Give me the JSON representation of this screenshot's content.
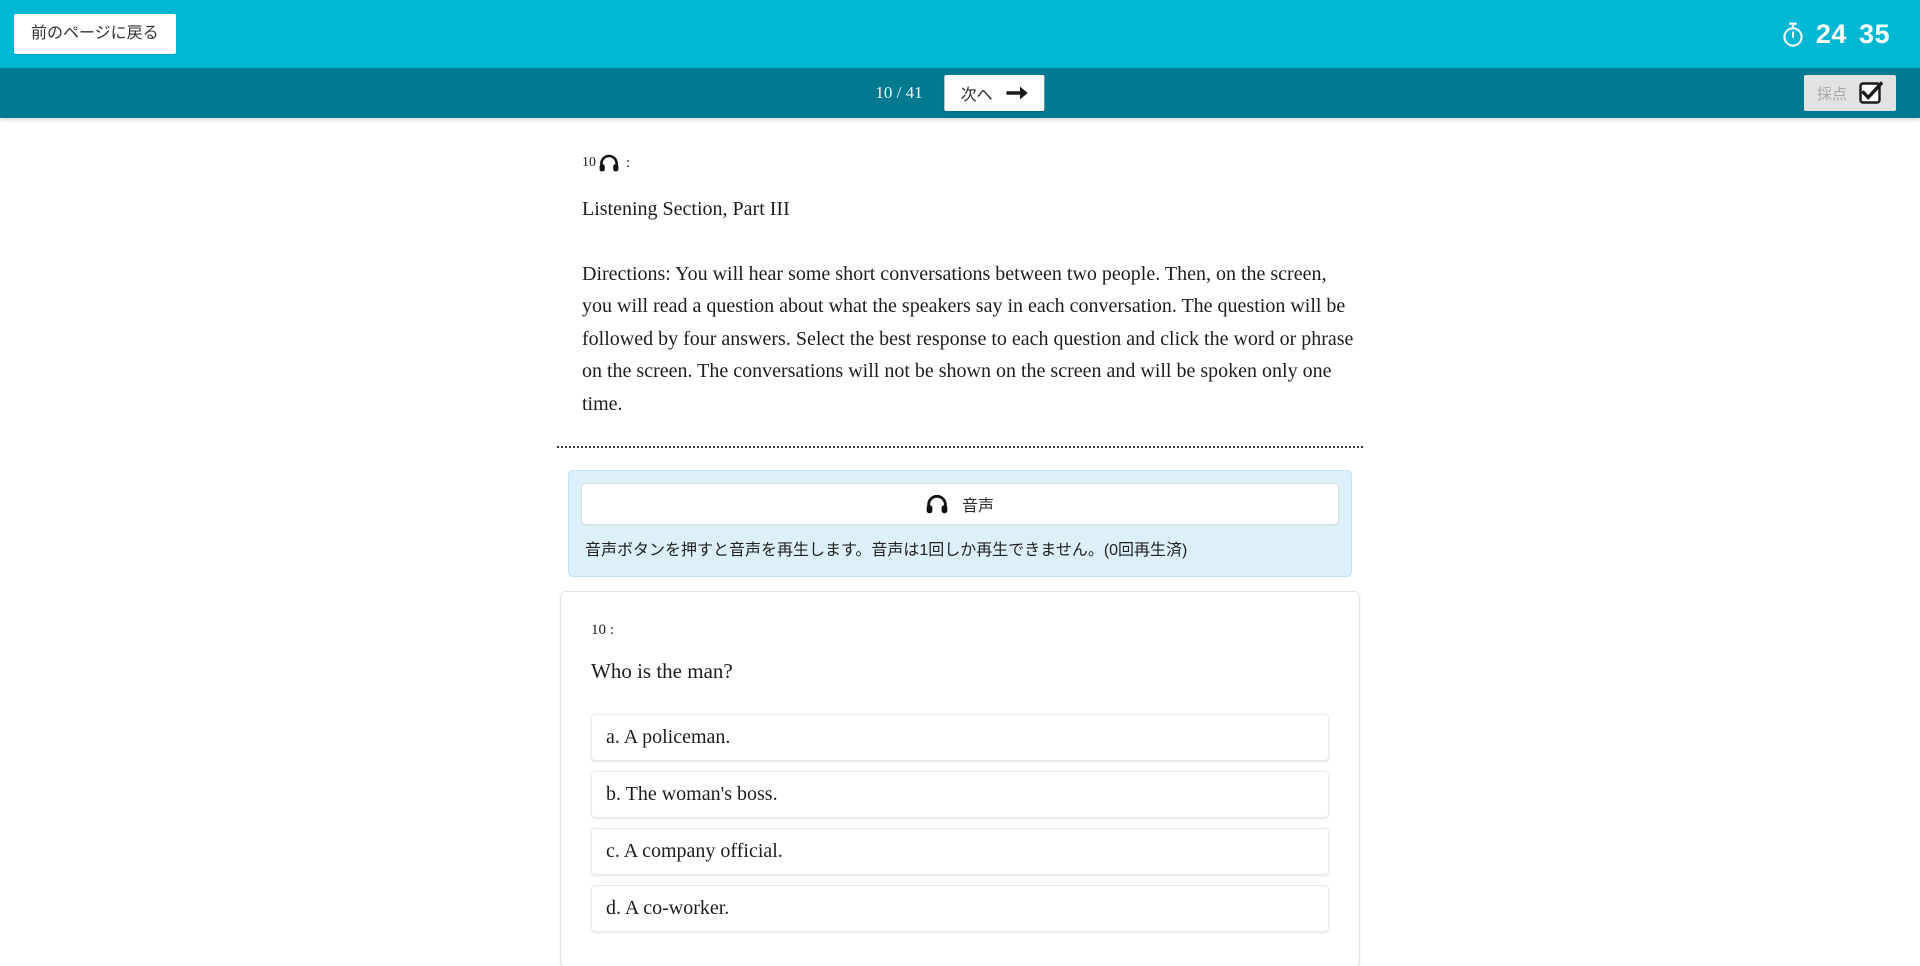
{
  "topbar": {
    "back_label": "前のページに戻る",
    "timer_icon": "stopwatch-icon",
    "timer_minutes": "24",
    "timer_seconds": "35",
    "background_color": "#00b8d4"
  },
  "navbar": {
    "page_indicator": "10 / 41",
    "next_label": "次へ",
    "next_icon": "arrow-right-icon",
    "grade_label": "採点",
    "grade_icon": "checkbox-checked-icon",
    "background_color": "#017a91"
  },
  "passage": {
    "question_number": "10",
    "headphone_icon": "headphones-icon",
    "colon": ":",
    "section_title": "Listening Section, Part III",
    "directions": "Directions: You will hear some short conversations between two people. Then, on the screen, you will read a question about what the speakers say in each conversation. The question will be followed by four answers. Select the best response to each question and click the word or phrase on the screen. The conversations will not be shown on the screen and will be spoken only one time."
  },
  "audio": {
    "button_label": "音声",
    "button_icon": "headphones-icon",
    "note": "音声ボタンを押すと音声を再生します。音声は1回しか再生できません。(0回再生済)",
    "panel_color": "#ddf0fa"
  },
  "question": {
    "number_label": "10 :",
    "text": "Who is the man?",
    "choices": [
      {
        "label": "a. A policeman."
      },
      {
        "label": "b. The woman's boss."
      },
      {
        "label": "c. A company official."
      },
      {
        "label": "d. A co-worker."
      }
    ]
  }
}
